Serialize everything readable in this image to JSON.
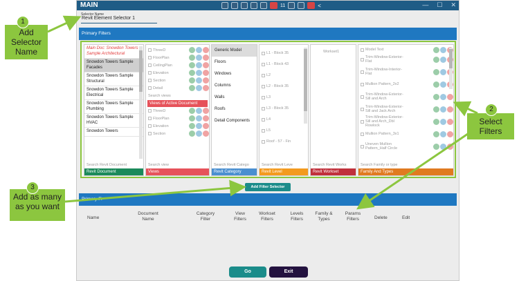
{
  "window": {
    "title": "MAIN",
    "toolbar_count": "11",
    "toolbar_chevron": "<",
    "win_buttons": [
      "—",
      "☐",
      "✕"
    ]
  },
  "selector_name": {
    "label": "Selector Name",
    "value": "Revit Element Selector 1"
  },
  "primary_filters_title": "Primary Filters",
  "primary_filters_title2": "Primary Fi",
  "documents": {
    "items": [
      {
        "label": "Main Doc: Snowdon Towers Sample Architectural",
        "style": "red"
      },
      {
        "label": "Snowdon Towers Sample Facades",
        "style": "sel"
      },
      {
        "label": "Snowdon Towers Sample Structural",
        "style": ""
      },
      {
        "label": "Snowdon Towers Sample Electrical",
        "style": ""
      },
      {
        "label": "Snowdon Towers Sample Plumbing",
        "style": ""
      },
      {
        "label": "Snowdon Towers Sample HVAC",
        "style": ""
      },
      {
        "label": "Snowdon Towers",
        "style": ""
      }
    ],
    "search": "Search Revit Document",
    "footer": "Revit Document"
  },
  "views": {
    "top": [
      "ThreeD",
      "FloorPlan",
      "CeilingPlan",
      "Elevation",
      "Section",
      "Detail"
    ],
    "search1": "Search views",
    "active_header": "Views of Active Document",
    "bottom": [
      "ThreeD",
      "FloorPlan",
      "Elevation",
      "Section"
    ],
    "search2": "Search view",
    "footer": "Views"
  },
  "categories": {
    "items": [
      "Generic Model",
      "Floors",
      "Windows",
      "Columns",
      "Walls",
      "Roofs",
      "Detail Components"
    ],
    "search": "Search Revit Catego",
    "footer": "Revit Category"
  },
  "levels": {
    "items": [
      "L1 - Block 35",
      "L1 - Block 43",
      "L2",
      "L2 - Block 35",
      "L3",
      "L3 - Block 35",
      "L4",
      "L5",
      "Roof - 57 - Fin"
    ],
    "search": "Search Revit Leve",
    "footer": "Revit Level"
  },
  "worksets": {
    "items": [
      "Workset1"
    ],
    "search": "Search Revit Works",
    "footer": "Revit Workset"
  },
  "families": {
    "items": [
      "Model Text",
      "Trim-Window-Exterior-Flat",
      "Trim-Window-Interior-Flat",
      "Mullion Pattern_2x2",
      "Trim-Window-Exterior-Sill and Arch",
      "Trim-Window-Exterior-Sill and Jack Arch",
      "Trim-Window-Exterior-Sill and Arch_Dbl Rowlock",
      "Mullion Pattern_3x1",
      "Uneven Mullion Pattern_Half Circle"
    ],
    "search": "Search Family or type",
    "footer": "Family And Types"
  },
  "add_filter_label": "Add Filter Selector",
  "headers": [
    "Name",
    "Document Name",
    "Category Filter",
    "View Filters",
    "Workset Filters",
    "Levels Filters",
    "Family & Types",
    "Params Filters",
    "Delete",
    "Edit"
  ],
  "go_label": "Go",
  "exit_label": "Exit",
  "callouts": [
    {
      "num": "1",
      "text": "Add Selector Name"
    },
    {
      "num": "2",
      "text": "Select Filters"
    },
    {
      "num": "3",
      "text": "Add as many as you want"
    }
  ],
  "colors": {
    "accent_green": "#8cc63f",
    "title_blue": "#1f5c86",
    "bar_blue": "#1f78c1",
    "teal": "#1b8c8a",
    "dark": "#23123f",
    "doc_footer": "#1b8a5a",
    "views_footer": "#e6525a",
    "category_footer": "#4a8fd0",
    "level_footer": "#f39a1e",
    "workset_footer": "#c0303b",
    "family_footer": "#e07a20"
  }
}
